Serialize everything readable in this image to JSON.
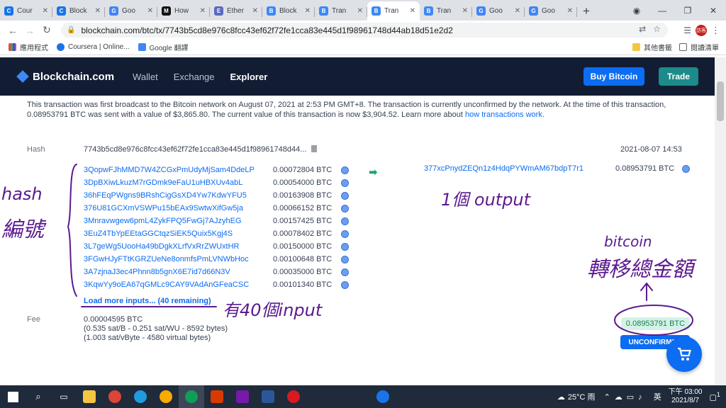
{
  "browser": {
    "tabs": [
      {
        "label": "Cour",
        "color": "#1a73e8",
        "letter": "C"
      },
      {
        "label": "Block",
        "color": "#1a73e8",
        "letter": "C"
      },
      {
        "label": "Goo",
        "color": "#4285f4",
        "letter": "G"
      },
      {
        "label": "How",
        "color": "#111111",
        "letter": "M"
      },
      {
        "label": "Ether",
        "color": "#5a6bbf",
        "letter": "E"
      },
      {
        "label": "Block",
        "color": "#3d89f5",
        "letter": "B"
      },
      {
        "label": "Tran",
        "color": "#3d89f5",
        "letter": "B"
      },
      {
        "label": "Tran",
        "color": "#3d89f5",
        "letter": "B",
        "active": true
      },
      {
        "label": "Tran",
        "color": "#3d89f5",
        "letter": "B"
      },
      {
        "label": "Goo",
        "color": "#4285f4",
        "letter": "G"
      },
      {
        "label": "Goo",
        "color": "#4285f4",
        "letter": "G"
      }
    ],
    "address": "blockchain.com/btc/tx/7743b5cd8e976c8fcc43ef62f72fe1cca83e445d1f98961748d44ab18d51e2d2",
    "profile": "訪客",
    "bookmarks": [
      {
        "label": "應用程式"
      },
      {
        "label": "Coursera | Online..."
      },
      {
        "label": "Google 翻譯"
      }
    ],
    "bookmarks_right": [
      "其他書籤",
      "閱讀清單"
    ]
  },
  "site": {
    "logo": "Blockchain.com",
    "nav": [
      "Wallet",
      "Exchange",
      "Explorer"
    ],
    "buy_label": "Buy Bitcoin",
    "trade_label": "Trade",
    "buy_color": "#0c6cf2",
    "trade_color": "#1c8b8a"
  },
  "tx": {
    "intro_text": "This transaction was first broadcast to the Bitcoin network on August 07, 2021 at 2:53 PM GMT+8.  The transaction is currently unconfirmed by the network.  At the time of this transaction, 0.08953791 BTC was sent with a value of $3,865.80. The current value of this transaction is now $3,904.52.  Learn more about ",
    "intro_link": "how transactions work.",
    "hash_label": "Hash",
    "hash": "7743b5cd8e976c8fcc43ef62f72fe1cca83e445d1f98961748d44...",
    "date": "2021-08-07 14:53",
    "inputs": [
      {
        "addr": "3QopwFJhMMD7W4ZCGxPmUdyMjSam4DdeLP",
        "amt": "0.00072804 BTC"
      },
      {
        "addr": "3DpBXiwLkuzM7rGDmk9eFaU1uHBXUv4abL",
        "amt": "0.00054000 BTC"
      },
      {
        "addr": "36hFEqPWgns9BRshCigGsXD4Yw7KdwYFU5",
        "amt": "0.00163908 BTC"
      },
      {
        "addr": "376U81GCXmVSWPu15bEAx9SwtwXifGw5ja",
        "amt": "0.00066152 BTC"
      },
      {
        "addr": "3Mnravwgew6pmL4ZykFPQ5FwGj7AJzyhEG",
        "amt": "0.00157425 BTC"
      },
      {
        "addr": "3EuZ4TbYpEEtaGGCtqzSiEK5Quix5Kgj4S",
        "amt": "0.00078402 BTC"
      },
      {
        "addr": "3L7geWg5UooHa49bDgkXLrfVxRrZWUxtHR",
        "amt": "0.00150000 BTC"
      },
      {
        "addr": "3FGwHJyFTtKGRZUeNe8onmfsPmLVNWbHoc",
        "amt": "0.00100648 BTC"
      },
      {
        "addr": "3A7zjnaJ3ec4Phnn8b5gnX6E7id7d66N3V",
        "amt": "0.00035000 BTC"
      },
      {
        "addr": "3KqwYy9oEA67qGMLc9CAY9VAdAnGFeaCSC",
        "amt": "0.00101340 BTC"
      }
    ],
    "output_addr": "377xcPnydZEQn1z4HdqPYWmAM67bdpT7r1",
    "output_amt": "0.08953791 BTC",
    "load_more": "Load more inputs... (40 remaining)",
    "fee_label": "Fee",
    "fee_lines": [
      "0.00004595 BTC",
      "(0.535 sat/B - 0.251 sat/WU - 8592 bytes)",
      "(1.003 sat/vByte - 4580 virtual bytes)"
    ],
    "total": "0.08953791 BTC",
    "status": "UNCONFIRMED"
  },
  "annotations": {
    "hash_note": [
      "hash",
      "編號"
    ],
    "output_note": "1個 output",
    "input_note": "有40個input",
    "btc_note": [
      "bitcoin",
      "轉移總金額"
    ],
    "ink_color": "#5b1a8f"
  },
  "taskbar": {
    "weather": "25°C 雨",
    "ime": "英",
    "time": "下午 03:00",
    "date": "2021/8/7",
    "notif_count": "1"
  }
}
